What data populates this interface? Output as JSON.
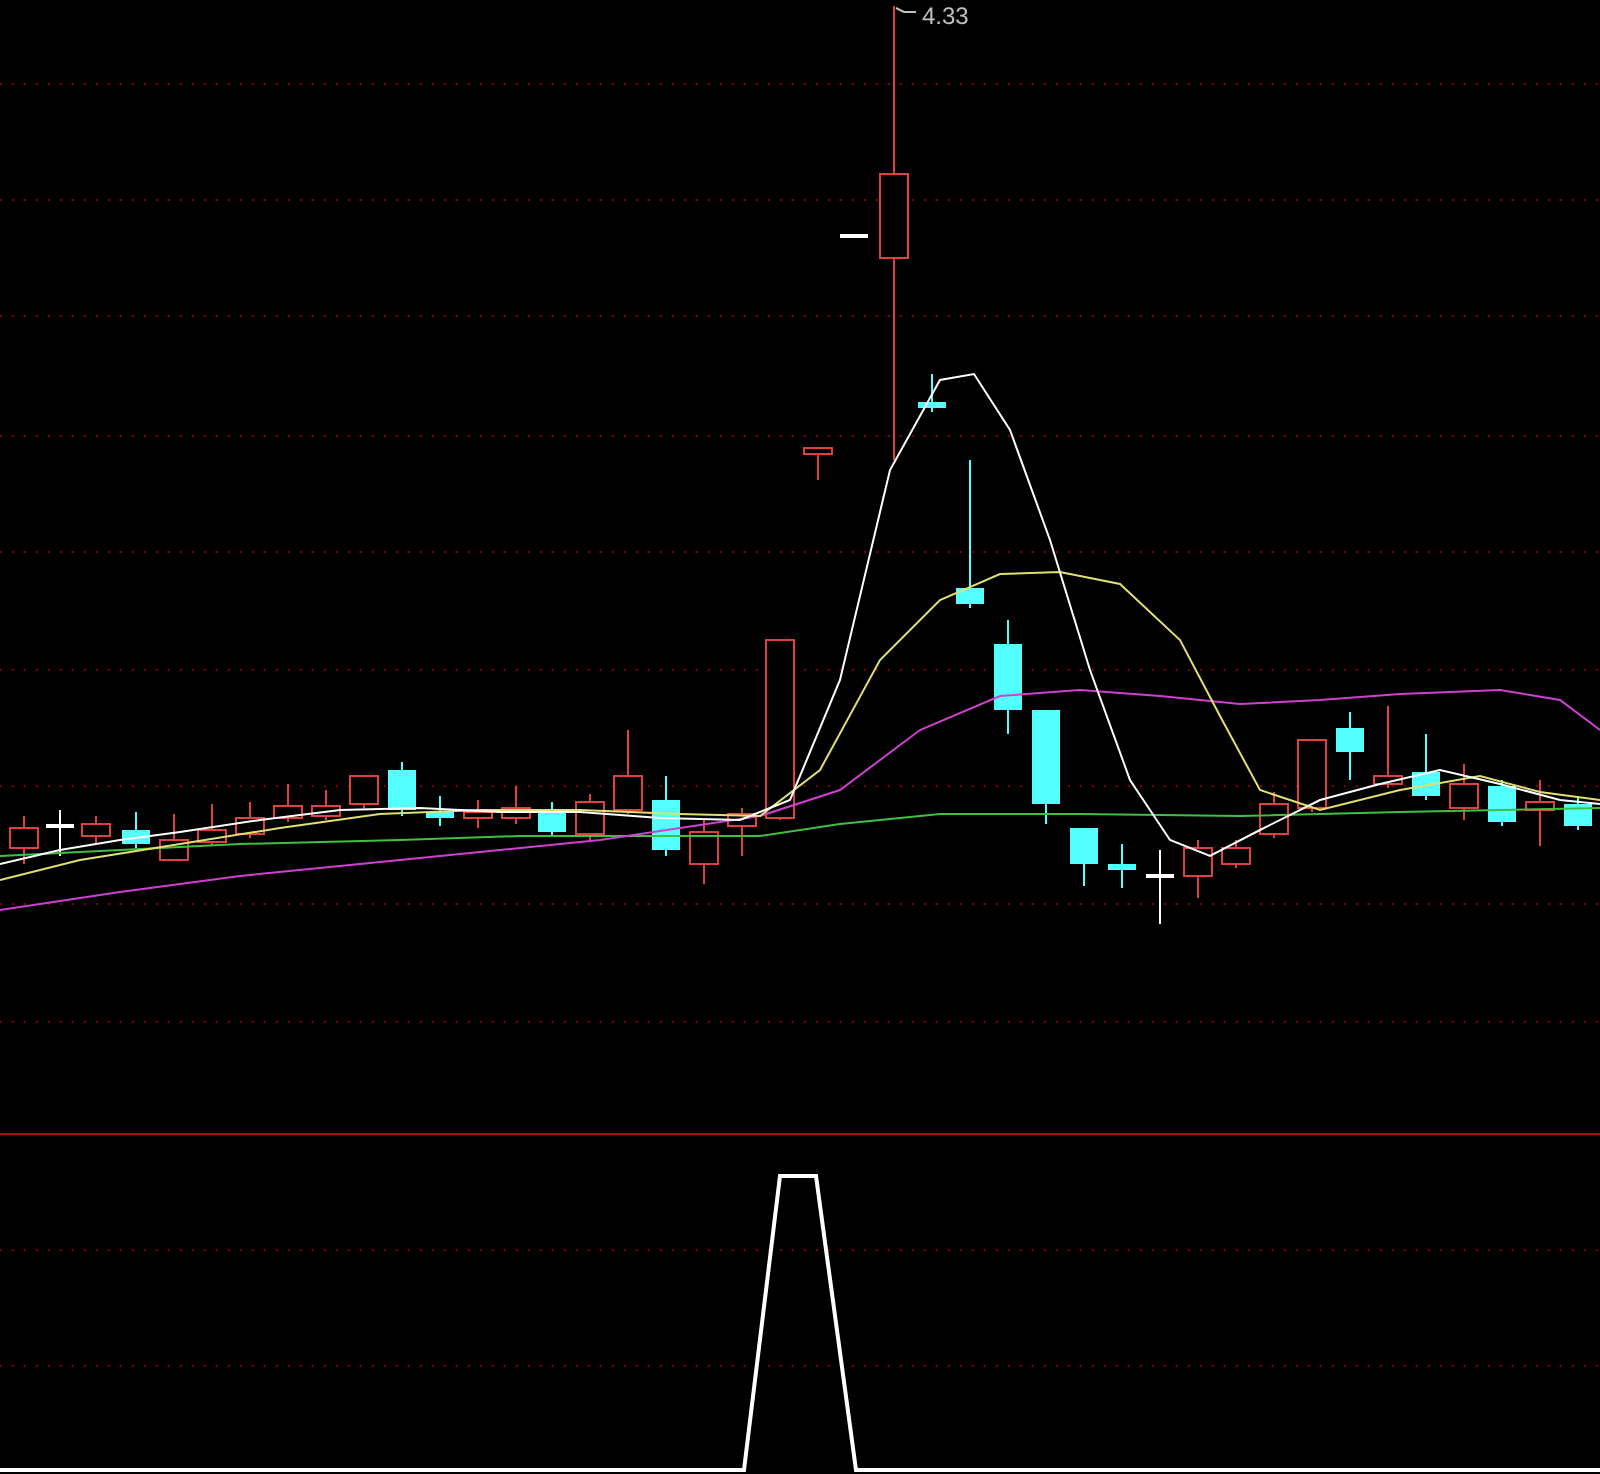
{
  "price_chart": {
    "peak_price_label": "4.33"
  }
}
